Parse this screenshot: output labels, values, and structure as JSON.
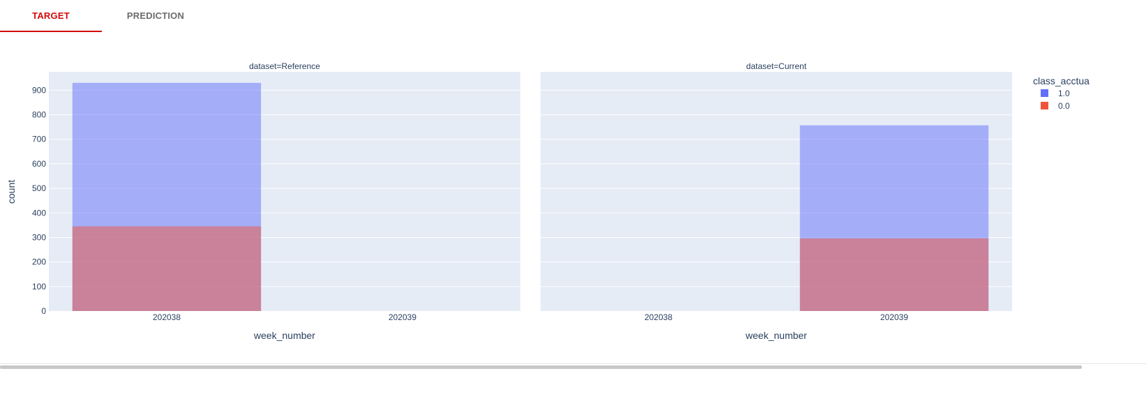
{
  "tabs": [
    {
      "label": "TARGET",
      "active": true
    },
    {
      "label": "PREDICTION",
      "active": false
    }
  ],
  "colors": {
    "active_tab": "#d10a0a",
    "inactive_tab": "#6b6b6b",
    "plot_bg": "#e5ecf6",
    "series_1_0": "#636efa",
    "series_0_0": "#ef553b"
  },
  "chart_data": {
    "type": "bar",
    "barmode": "overlay",
    "opacity": 0.5,
    "xlabel": "week_number",
    "ylabel": "count",
    "ylim": [
      0,
      950
    ],
    "yticks": [
      0,
      100,
      200,
      300,
      400,
      500,
      600,
      700,
      800,
      900
    ],
    "categories": [
      "202038",
      "202039"
    ],
    "legend": {
      "title": "class_acctua",
      "placement": "top-right",
      "entries": [
        "1.0",
        "0.0"
      ]
    },
    "grid": true,
    "facets": [
      {
        "title": "dataset=Reference",
        "series": [
          {
            "name": "1.0",
            "values": [
              930,
              0
            ]
          },
          {
            "name": "0.0",
            "values": [
              345,
              0
            ]
          }
        ]
      },
      {
        "title": "dataset=Current",
        "series": [
          {
            "name": "1.0",
            "values": [
              0,
              757
            ]
          },
          {
            "name": "0.0",
            "values": [
              0,
              296
            ]
          }
        ]
      }
    ]
  }
}
